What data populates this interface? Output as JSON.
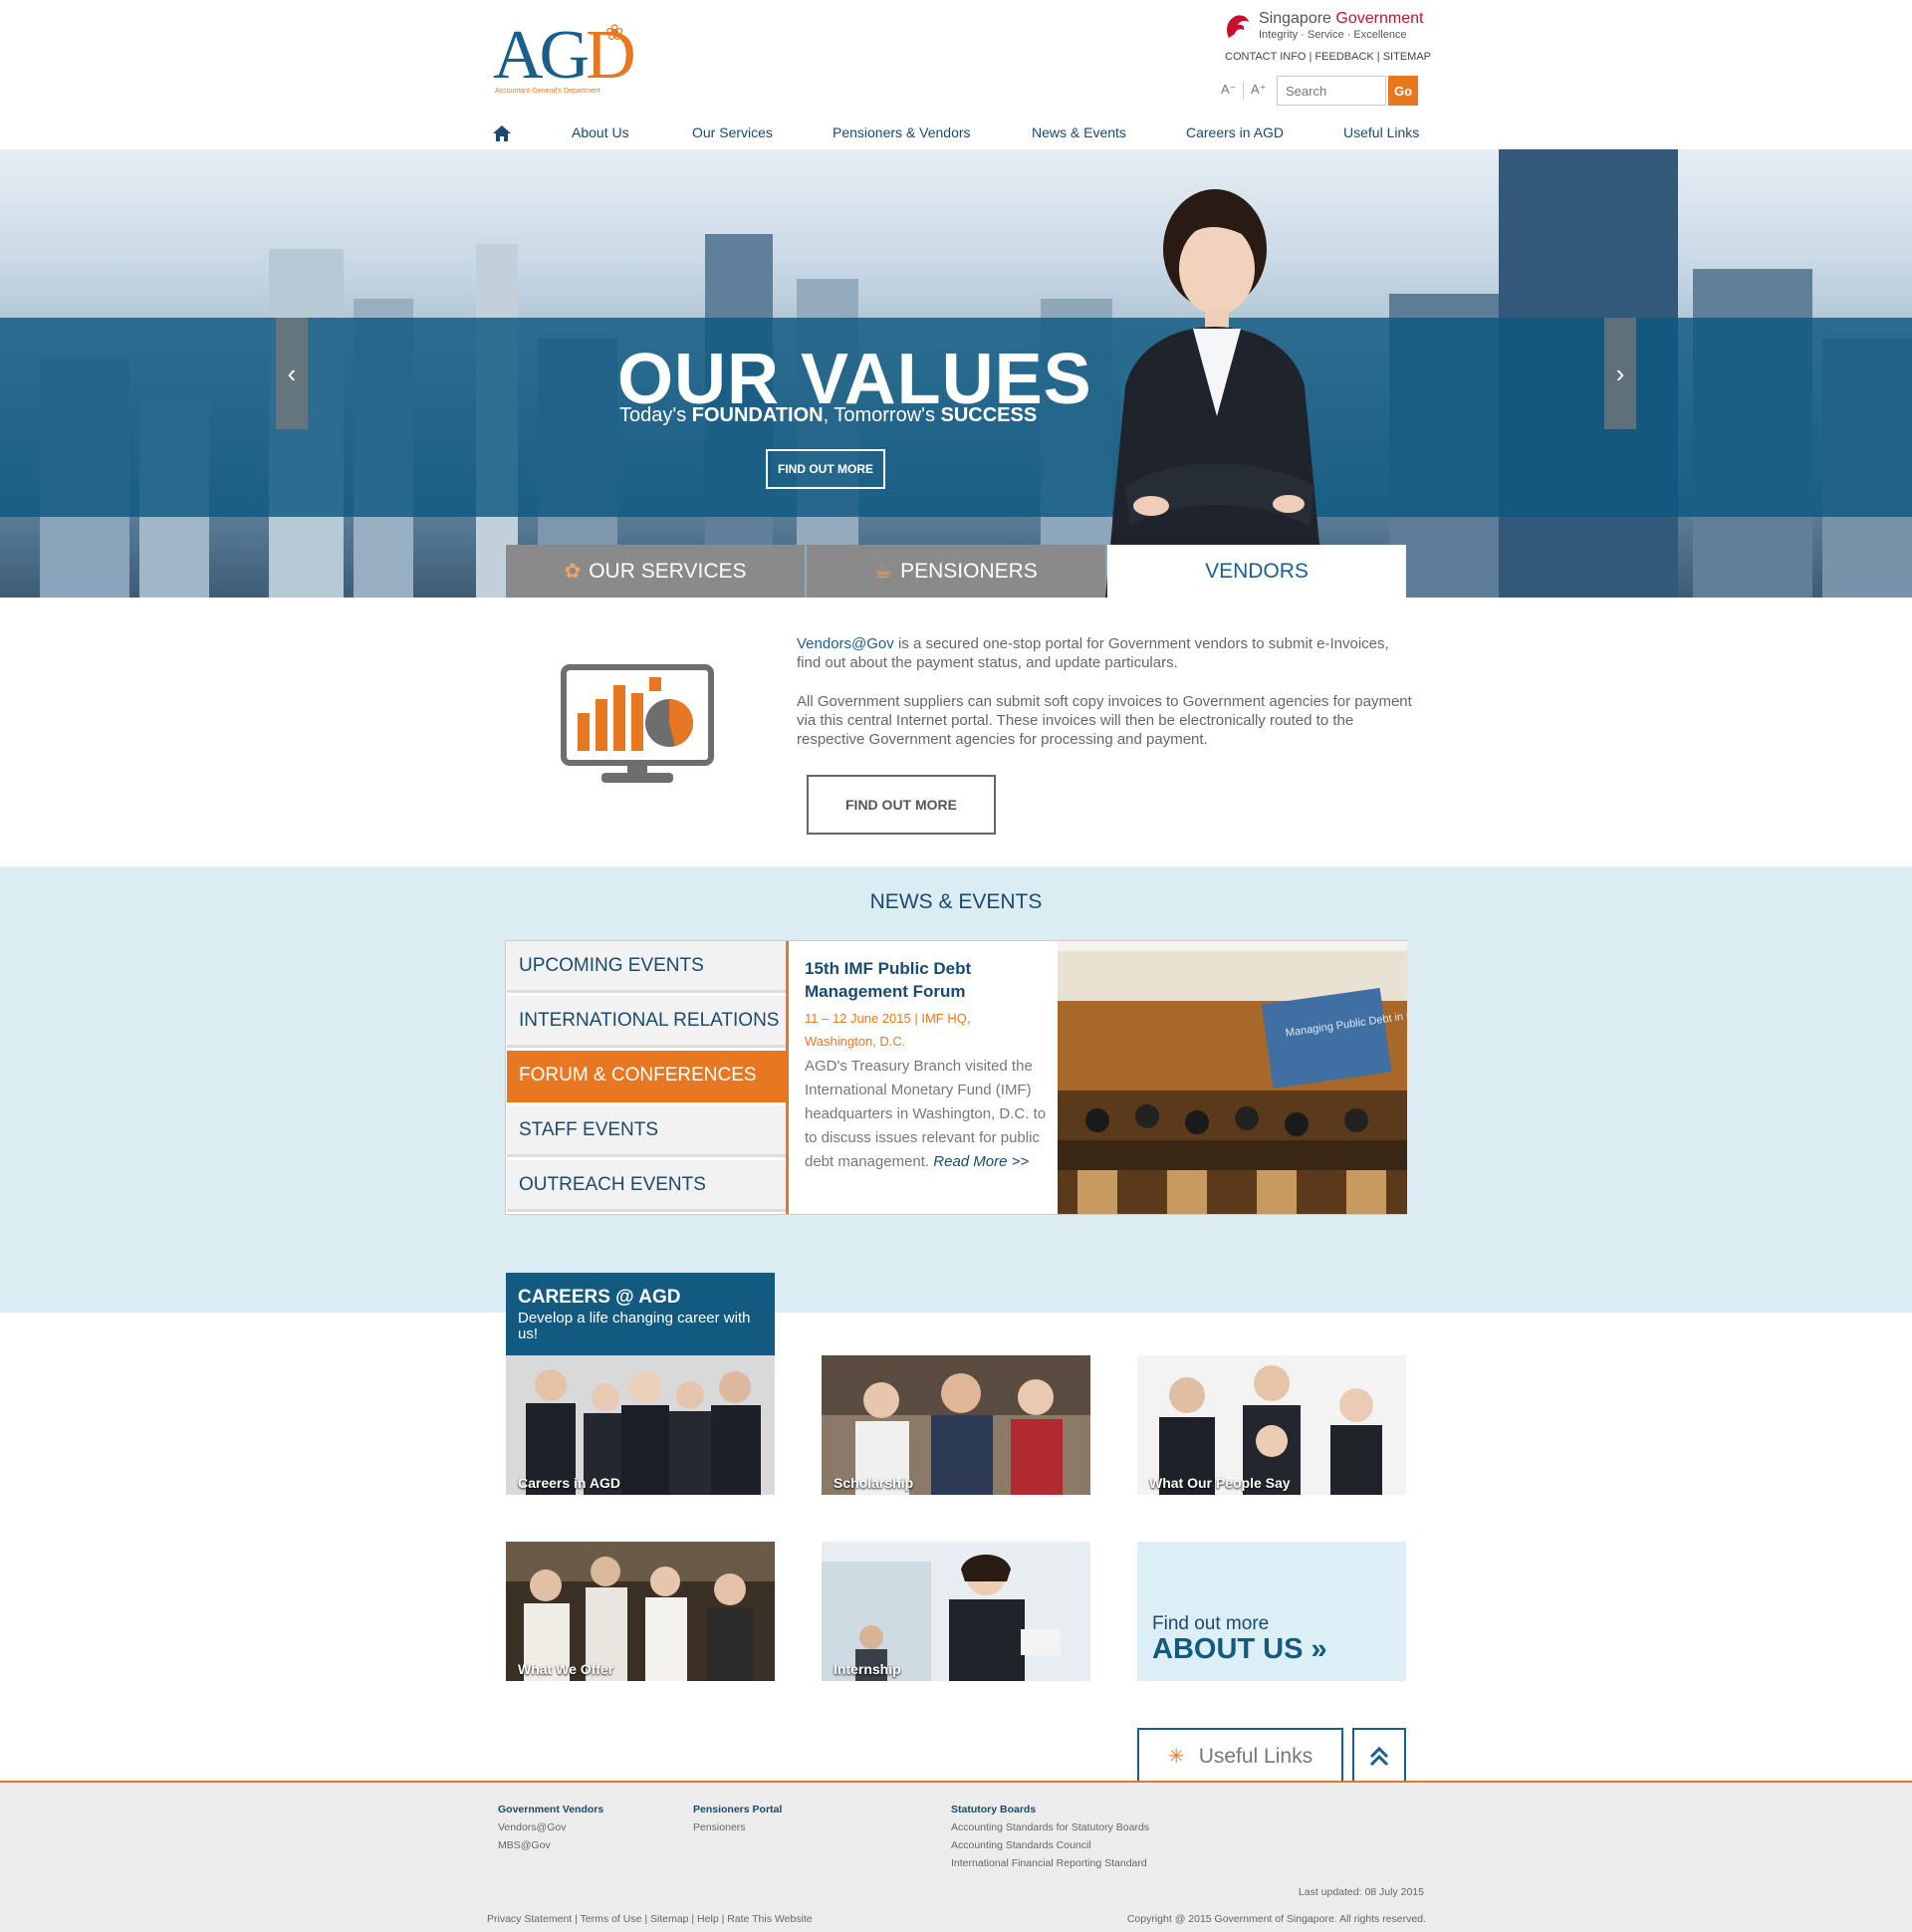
{
  "header": {
    "logo_text_a": "AG",
    "logo_text_d": "D",
    "logo_sub": "Accountant-General's Department",
    "sg_gov_title_prefix": "Singapore ",
    "sg_gov_title_gov": "Government",
    "sg_gov_tagline": "Integrity · Service · Excellence",
    "util_links": "CONTACT INFO | FEEDBACK | SITEMAP",
    "font_decrease": "A⁻",
    "font_increase": "A⁺",
    "search_placeholder": "Search",
    "search_button": "Go"
  },
  "nav": {
    "items": [
      "About Us",
      "Our Services",
      "Pensioners & Vendors",
      "News & Events",
      "Careers in AGD",
      "Useful Links"
    ]
  },
  "hero": {
    "title": "OUR VALUES",
    "subtitle_1": "Today's ",
    "subtitle_2": "FOUNDATION",
    "subtitle_3": ", Tomorrow's ",
    "subtitle_4": "SUCCESS",
    "button": "FIND OUT MORE",
    "prev": "‹",
    "next": "›"
  },
  "tabs": {
    "services": "OUR SERVICES",
    "pensioners": "PENSIONERS",
    "vendors": "VENDORS",
    "active": "VENDORS"
  },
  "vendors": {
    "brand": "Vendors@Gov",
    "p1_rest": " is a secured one-stop portal for Government vendors to submit e-Invoices, find out about the payment status, and update particulars.",
    "p2": "All Government suppliers can submit soft copy invoices to Government agencies for payment via this central Internet portal. These invoices will then be electronically routed to the respective Government agencies for processing and payment.",
    "button": "FIND OUT MORE"
  },
  "news": {
    "title": "NEWS & EVENTS",
    "categories": [
      "UPCOMING EVENTS",
      "INTERNATIONAL RELATIONS",
      "FORUM & CONFERENCES",
      "STAFF EVENTS",
      "OUTREACH EVENTS"
    ],
    "active_category": "FORUM & CONFERENCES",
    "article": {
      "title": "15th IMF Public Debt Management Forum",
      "date": "11 – 12 June 2015 | IMF HQ, Washington, D.C.",
      "body": "AGD's Treasury Branch visited the International Monetary Fund (IMF) headquarters in Washington, D.C. to to discuss issues relevant for public debt management. ",
      "read_more": "Read More >>"
    },
    "photo_screen_text": "Managing Public Debt in Challenging Markets"
  },
  "careers": {
    "heading": "CAREERS @ AGD",
    "sub": "Develop a life changing career with us!",
    "tiles": [
      "Careers in AGD",
      "Scholarship",
      "What Our People Say",
      "What We Offer",
      "Internship"
    ],
    "about_find": "Find out more",
    "about_big": "ABOUT US »"
  },
  "useful_links_button": "Useful Links",
  "back_to_top": "⌃",
  "footer": {
    "col1": {
      "heading": "Government Vendors",
      "links": [
        "Vendors@Gov",
        "MBS@Gov"
      ]
    },
    "col2": {
      "heading": "Pensioners Portal",
      "links": [
        "Pensioners"
      ]
    },
    "col3": {
      "heading": "Statutory Boards",
      "links": [
        "Accounting Standards for Statutory Boards",
        "Accounting Standards Council",
        "International Financial Reporting Standard"
      ]
    },
    "last_updated": "Last updated: 08 July 2015",
    "bottom_links": "Privacy Statement | Terms of Use | Sitemap | Help | Rate This Website",
    "copyright": "Copyright @ 2015 Government of Singapore. All rights reserved."
  },
  "colors": {
    "brand_blue": "#1a5f8a",
    "brand_orange": "#e87722",
    "gov_red": "#c8102e"
  }
}
